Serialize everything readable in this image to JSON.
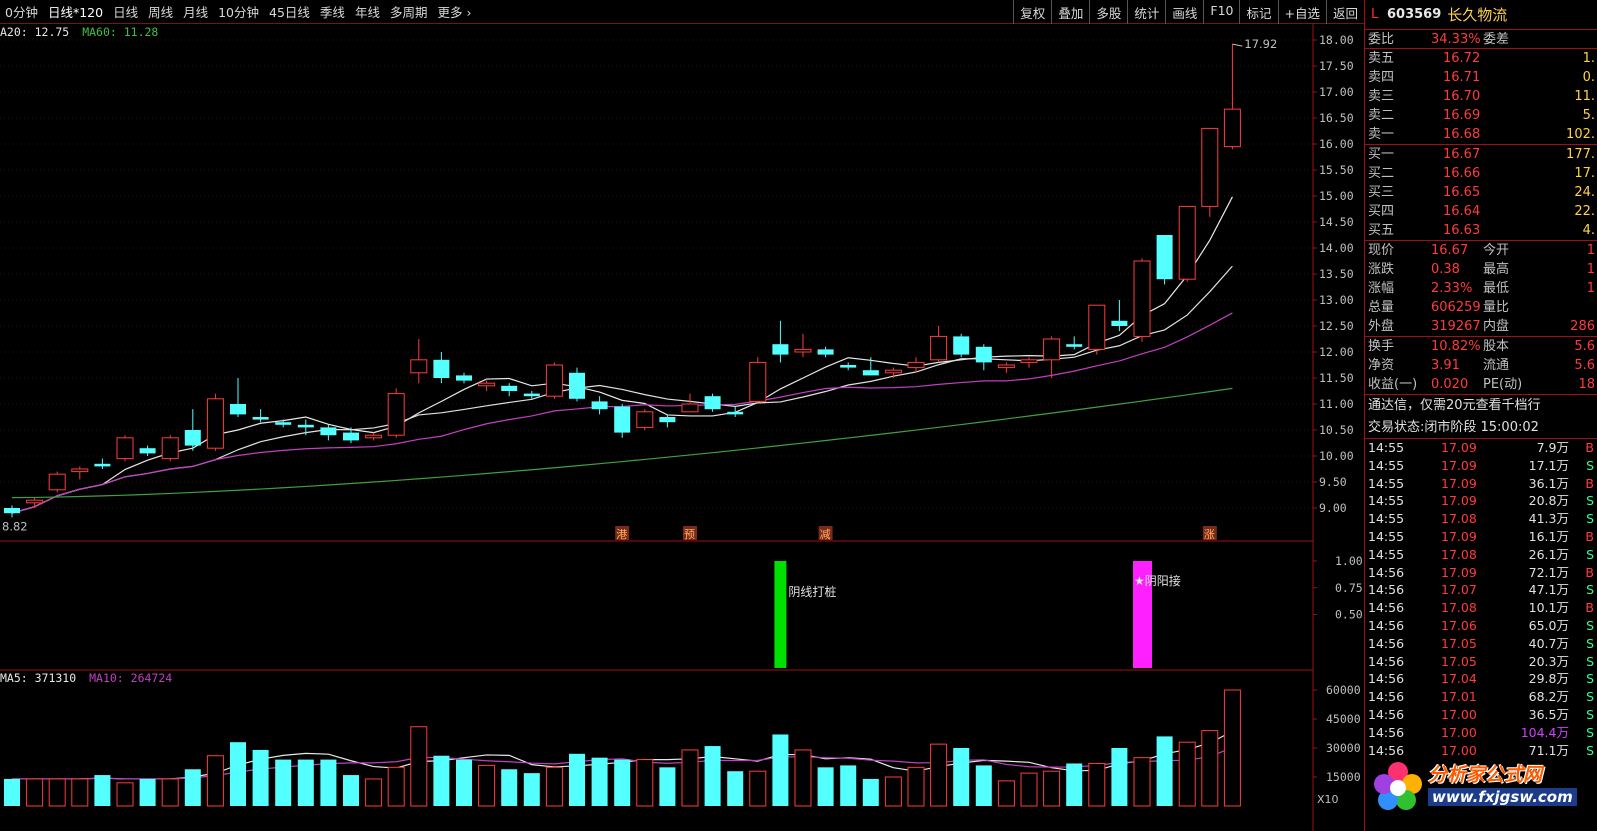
{
  "toolbar": {
    "periods": [
      "0分钟",
      "日线*120",
      "日线",
      "周线",
      "月线",
      "10分钟",
      "45日线",
      "季线",
      "年线",
      "多周期",
      "更多"
    ],
    "right_buttons": [
      "复权",
      "叠加",
      "多股",
      "统计",
      "画线",
      "F10",
      "标记",
      "+自选",
      "返回"
    ]
  },
  "legend": {
    "ma20": "A20: 12.75",
    "ma60": "MA60: 11.28",
    "vol_ma5": "MA5: 371310",
    "vol_ma10": "MA10: 264724"
  },
  "main_chart": {
    "high_label": "17.92",
    "low_label": "8.82",
    "y_ticks": [
      "18.00",
      "17.50",
      "17.00",
      "16.50",
      "16.00",
      "15.50",
      "15.00",
      "14.50",
      "14.00",
      "13.50",
      "13.00",
      "12.50",
      "12.00",
      "11.50",
      "11.00",
      "10.50",
      "10.00",
      "9.50",
      "9.00"
    ],
    "events": [
      "港",
      "预",
      "减",
      "涨"
    ]
  },
  "indicator": {
    "y_ticks": [
      "1.00",
      "0.75",
      "0.50"
    ],
    "signal1": "阴线打桩",
    "signal2": "★阴阳接"
  },
  "volume": {
    "y_ticks": [
      "60000",
      "45000",
      "30000",
      "15000"
    ],
    "scale_label": "X10"
  },
  "quote": {
    "market": "L",
    "code": "603569",
    "name": "长久物流",
    "weibi": {
      "label": "委比",
      "value": "34.33%",
      "label2": "委差"
    },
    "sells": [
      {
        "label": "卖五",
        "price": "16.72",
        "vol": "1."
      },
      {
        "label": "卖四",
        "price": "16.71",
        "vol": "0."
      },
      {
        "label": "卖三",
        "price": "16.70",
        "vol": "11."
      },
      {
        "label": "卖二",
        "price": "16.69",
        "vol": "5."
      },
      {
        "label": "卖一",
        "price": "16.68",
        "vol": "102."
      }
    ],
    "buys": [
      {
        "label": "买一",
        "price": "16.67",
        "vol": "177."
      },
      {
        "label": "买二",
        "price": "16.66",
        "vol": "17."
      },
      {
        "label": "买三",
        "price": "16.65",
        "vol": "24."
      },
      {
        "label": "买四",
        "price": "16.64",
        "vol": "22."
      },
      {
        "label": "买五",
        "price": "16.63",
        "vol": "4."
      }
    ],
    "stats1": [
      {
        "l1": "现价",
        "v1": "16.67",
        "l2": "今开",
        "v2": "1"
      },
      {
        "l1": "涨跌",
        "v1": "0.38",
        "l2": "最高",
        "v2": "1"
      },
      {
        "l1": "涨幅",
        "v1": "2.33%",
        "l2": "最低",
        "v2": "1"
      },
      {
        "l1": "总量",
        "v1": "606259",
        "l2": "量比",
        "v2": ""
      },
      {
        "l1": "外盘",
        "v1": "319267",
        "l2": "内盘",
        "v2": "286"
      }
    ],
    "stats2": [
      {
        "l1": "换手",
        "v1": "10.82%",
        "l2": "股本",
        "v2": "5.6"
      },
      {
        "l1": "净资",
        "v1": "3.91",
        "l2": "流通",
        "v2": "5.6"
      },
      {
        "l1": "收益(一)",
        "v1": "0.020",
        "l2": "PE(动)",
        "v2": "18"
      }
    ],
    "notice": "通达信，仅需20元查看千档行",
    "trade_state": "交易状态:闭市阶段 15:00:02",
    "ticks": [
      {
        "t": "14:55",
        "p": "17.09",
        "v": "7.9万",
        "bs": "B"
      },
      {
        "t": "14:55",
        "p": "17.09",
        "v": "17.1万",
        "bs": "S"
      },
      {
        "t": "14:55",
        "p": "17.09",
        "v": "36.1万",
        "bs": "B"
      },
      {
        "t": "14:55",
        "p": "17.09",
        "v": "20.8万",
        "bs": "S"
      },
      {
        "t": "14:55",
        "p": "17.08",
        "v": "41.3万",
        "bs": "S"
      },
      {
        "t": "14:55",
        "p": "17.09",
        "v": "16.1万",
        "bs": "B"
      },
      {
        "t": "14:55",
        "p": "17.08",
        "v": "26.1万",
        "bs": "S"
      },
      {
        "t": "14:56",
        "p": "17.09",
        "v": "72.1万",
        "bs": "B"
      },
      {
        "t": "14:56",
        "p": "17.07",
        "v": "47.1万",
        "bs": "S"
      },
      {
        "t": "14:56",
        "p": "17.08",
        "v": "10.1万",
        "bs": "B"
      },
      {
        "t": "14:56",
        "p": "17.06",
        "v": "65.0万",
        "bs": "S"
      },
      {
        "t": "14:56",
        "p": "17.05",
        "v": "40.7万",
        "bs": "S"
      },
      {
        "t": "14:56",
        "p": "17.05",
        "v": "20.3万",
        "bs": "S"
      },
      {
        "t": "14:56",
        "p": "17.04",
        "v": "29.8万",
        "bs": "S"
      },
      {
        "t": "14:56",
        "p": "17.01",
        "v": "68.2万",
        "bs": "S"
      },
      {
        "t": "14:56",
        "p": "17.00",
        "v": "36.5万",
        "bs": "S"
      },
      {
        "t": "14:56",
        "p": "17.00",
        "v": "104.4万",
        "bs": "S"
      },
      {
        "t": "14:56",
        "p": "17.00",
        "v": "71.1万",
        "bs": "S"
      }
    ]
  },
  "watermark": {
    "text": "分析家公式网",
    "url": "www.fxjgsw.com"
  },
  "colors": {
    "up": "#ff3b3b",
    "down": "#54ffff",
    "ma_white": "#e8e8e8",
    "ma_purple": "#c040c0",
    "ma_green": "#40a040",
    "signal_green": "#00e000",
    "signal_magenta": "#ff20ff",
    "frame": "#a01010"
  },
  "candles": [
    {
      "o": 9.0,
      "h": 9.05,
      "l": 8.82,
      "c": 8.9
    },
    {
      "o": 9.1,
      "h": 9.2,
      "l": 9.0,
      "c": 9.15
    },
    {
      "o": 9.35,
      "h": 9.7,
      "l": 9.3,
      "c": 9.65
    },
    {
      "o": 9.7,
      "h": 9.8,
      "l": 9.55,
      "c": 9.75
    },
    {
      "o": 9.85,
      "h": 9.95,
      "l": 9.75,
      "c": 9.8
    },
    {
      "o": 9.95,
      "h": 10.4,
      "l": 9.9,
      "c": 10.35
    },
    {
      "o": 10.15,
      "h": 10.2,
      "l": 10.0,
      "c": 10.05
    },
    {
      "o": 9.95,
      "h": 10.4,
      "l": 9.9,
      "c": 10.35
    },
    {
      "o": 10.5,
      "h": 10.9,
      "l": 10.1,
      "c": 10.2
    },
    {
      "o": 10.15,
      "h": 11.2,
      "l": 10.1,
      "c": 11.1
    },
    {
      "o": 11.0,
      "h": 11.5,
      "l": 10.75,
      "c": 10.8
    },
    {
      "o": 10.75,
      "h": 10.9,
      "l": 10.65,
      "c": 10.7
    },
    {
      "o": 10.65,
      "h": 10.7,
      "l": 10.55,
      "c": 10.6
    },
    {
      "o": 10.6,
      "h": 10.7,
      "l": 10.4,
      "c": 10.55
    },
    {
      "o": 10.55,
      "h": 10.6,
      "l": 10.3,
      "c": 10.4
    },
    {
      "o": 10.45,
      "h": 10.55,
      "l": 10.25,
      "c": 10.3
    },
    {
      "o": 10.35,
      "h": 10.45,
      "l": 10.3,
      "c": 10.4
    },
    {
      "o": 10.4,
      "h": 11.3,
      "l": 10.35,
      "c": 11.2
    },
    {
      "o": 11.6,
      "h": 12.25,
      "l": 11.4,
      "c": 11.85
    },
    {
      "o": 11.85,
      "h": 12.0,
      "l": 11.4,
      "c": 11.5
    },
    {
      "o": 11.55,
      "h": 11.6,
      "l": 11.4,
      "c": 11.45
    },
    {
      "o": 11.35,
      "h": 11.45,
      "l": 11.25,
      "c": 11.4
    },
    {
      "o": 11.35,
      "h": 11.4,
      "l": 11.15,
      "c": 11.25
    },
    {
      "o": 11.2,
      "h": 11.25,
      "l": 11.1,
      "c": 11.15
    },
    {
      "o": 11.15,
      "h": 11.8,
      "l": 11.1,
      "c": 11.75
    },
    {
      "o": 11.6,
      "h": 11.7,
      "l": 11.05,
      "c": 11.1
    },
    {
      "o": 11.05,
      "h": 11.15,
      "l": 10.8,
      "c": 10.9
    },
    {
      "o": 10.95,
      "h": 11.0,
      "l": 10.35,
      "c": 10.45
    },
    {
      "o": 10.55,
      "h": 10.9,
      "l": 10.5,
      "c": 10.85
    },
    {
      "o": 10.75,
      "h": 10.8,
      "l": 10.55,
      "c": 10.65
    },
    {
      "o": 10.85,
      "h": 11.2,
      "l": 10.85,
      "c": 11.0
    },
    {
      "o": 11.15,
      "h": 11.2,
      "l": 10.85,
      "c": 10.9
    },
    {
      "o": 10.85,
      "h": 10.95,
      "l": 10.75,
      "c": 10.8
    },
    {
      "o": 11.05,
      "h": 11.9,
      "l": 11.0,
      "c": 11.8
    },
    {
      "o": 12.15,
      "h": 12.6,
      "l": 11.8,
      "c": 11.95
    },
    {
      "o": 12.0,
      "h": 12.35,
      "l": 11.9,
      "c": 12.05
    },
    {
      "o": 12.05,
      "h": 12.1,
      "l": 11.9,
      "c": 11.95
    },
    {
      "o": 11.75,
      "h": 11.8,
      "l": 11.65,
      "c": 11.7
    },
    {
      "o": 11.65,
      "h": 11.9,
      "l": 11.55,
      "c": 11.55
    },
    {
      "o": 11.6,
      "h": 11.7,
      "l": 11.5,
      "c": 11.65
    },
    {
      "o": 11.7,
      "h": 11.9,
      "l": 11.6,
      "c": 11.8
    },
    {
      "o": 11.85,
      "h": 12.5,
      "l": 11.8,
      "c": 12.3
    },
    {
      "o": 12.3,
      "h": 12.35,
      "l": 11.9,
      "c": 11.95
    },
    {
      "o": 12.1,
      "h": 12.15,
      "l": 11.65,
      "c": 11.8
    },
    {
      "o": 11.7,
      "h": 11.8,
      "l": 11.6,
      "c": 11.75
    },
    {
      "o": 11.8,
      "h": 11.9,
      "l": 11.7,
      "c": 11.85
    },
    {
      "o": 11.85,
      "h": 12.3,
      "l": 11.5,
      "c": 12.25
    },
    {
      "o": 12.15,
      "h": 12.3,
      "l": 12.05,
      "c": 12.1
    },
    {
      "o": 12.05,
      "h": 12.55,
      "l": 11.95,
      "c": 12.9
    },
    {
      "o": 12.6,
      "h": 13.0,
      "l": 12.4,
      "c": 12.5
    },
    {
      "o": 12.3,
      "h": 13.8,
      "l": 12.2,
      "c": 13.75
    },
    {
      "o": 14.25,
      "h": 14.25,
      "l": 13.3,
      "c": 13.4
    },
    {
      "o": 13.4,
      "h": 14.8,
      "l": 13.35,
      "c": 14.8
    },
    {
      "o": 14.8,
      "h": 16.3,
      "l": 14.6,
      "c": 16.3
    },
    {
      "o": 15.95,
      "h": 17.92,
      "l": 15.9,
      "c": 16.67
    }
  ],
  "volumes": [
    140,
    140,
    140,
    140,
    160,
    120,
    140,
    140,
    190,
    260,
    330,
    290,
    240,
    240,
    240,
    160,
    140,
    200,
    410,
    260,
    240,
    210,
    190,
    170,
    200,
    270,
    250,
    240,
    240,
    200,
    290,
    310,
    180,
    180,
    370,
    290,
    200,
    210,
    140,
    150,
    200,
    320,
    300,
    210,
    130,
    170,
    180,
    220,
    220,
    300,
    250,
    360,
    330,
    390,
    600
  ]
}
